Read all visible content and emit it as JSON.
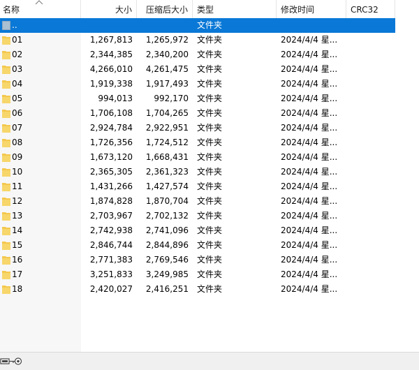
{
  "columns": {
    "name": "名称",
    "size": "大小",
    "packed_size": "压缩后大小",
    "type": "类型",
    "modified": "修改时间",
    "crc": "CRC32"
  },
  "sort": {
    "column": "name",
    "direction": "ascending"
  },
  "parent_row": {
    "name": "..",
    "type": "文件夹"
  },
  "rows": [
    {
      "name": "01",
      "size": "1,267,813",
      "packed": "1,265,972",
      "type": "文件夹",
      "modified": "2024/4/4 星..."
    },
    {
      "name": "02",
      "size": "2,344,385",
      "packed": "2,340,200",
      "type": "文件夹",
      "modified": "2024/4/4 星..."
    },
    {
      "name": "03",
      "size": "4,266,010",
      "packed": "4,261,475",
      "type": "文件夹",
      "modified": "2024/4/4 星..."
    },
    {
      "name": "04",
      "size": "1,919,338",
      "packed": "1,917,493",
      "type": "文件夹",
      "modified": "2024/4/4 星..."
    },
    {
      "name": "05",
      "size": "994,013",
      "packed": "992,170",
      "type": "文件夹",
      "modified": "2024/4/4 星..."
    },
    {
      "name": "06",
      "size": "1,706,108",
      "packed": "1,704,265",
      "type": "文件夹",
      "modified": "2024/4/4 星..."
    },
    {
      "name": "07",
      "size": "2,924,784",
      "packed": "2,922,951",
      "type": "文件夹",
      "modified": "2024/4/4 星..."
    },
    {
      "name": "08",
      "size": "1,726,356",
      "packed": "1,724,512",
      "type": "文件夹",
      "modified": "2024/4/4 星..."
    },
    {
      "name": "09",
      "size": "1,673,120",
      "packed": "1,668,431",
      "type": "文件夹",
      "modified": "2024/4/4 星..."
    },
    {
      "name": "10",
      "size": "2,365,305",
      "packed": "2,361,323",
      "type": "文件夹",
      "modified": "2024/4/4 星..."
    },
    {
      "name": "11",
      "size": "1,431,266",
      "packed": "1,427,574",
      "type": "文件夹",
      "modified": "2024/4/4 星..."
    },
    {
      "name": "12",
      "size": "1,874,828",
      "packed": "1,870,704",
      "type": "文件夹",
      "modified": "2024/4/4 星..."
    },
    {
      "name": "13",
      "size": "2,703,967",
      "packed": "2,702,132",
      "type": "文件夹",
      "modified": "2024/4/4 星..."
    },
    {
      "name": "14",
      "size": "2,742,938",
      "packed": "2,741,096",
      "type": "文件夹",
      "modified": "2024/4/4 星..."
    },
    {
      "name": "15",
      "size": "2,846,744",
      "packed": "2,844,896",
      "type": "文件夹",
      "modified": "2024/4/4 星..."
    },
    {
      "name": "16",
      "size": "2,771,383",
      "packed": "2,769,546",
      "type": "文件夹",
      "modified": "2024/4/4 星..."
    },
    {
      "name": "17",
      "size": "3,251,833",
      "packed": "3,249,985",
      "type": "文件夹",
      "modified": "2024/4/4 星..."
    },
    {
      "name": "18",
      "size": "2,420,027",
      "packed": "2,416,251",
      "type": "文件夹",
      "modified": "2024/4/4 星..."
    }
  ],
  "statusbar": {
    "text": "",
    "icon": "drive-key-icon"
  },
  "icons": {
    "folder": "folder-icon",
    "parent": "parent-folder-icon"
  },
  "colors": {
    "selection": "#0a78d7",
    "folder": "#f4c84e",
    "parent_icon": "#8fa9c0",
    "name_column_bg": "#f7f7f7",
    "statusbar_bg": "#f0f0f0"
  }
}
